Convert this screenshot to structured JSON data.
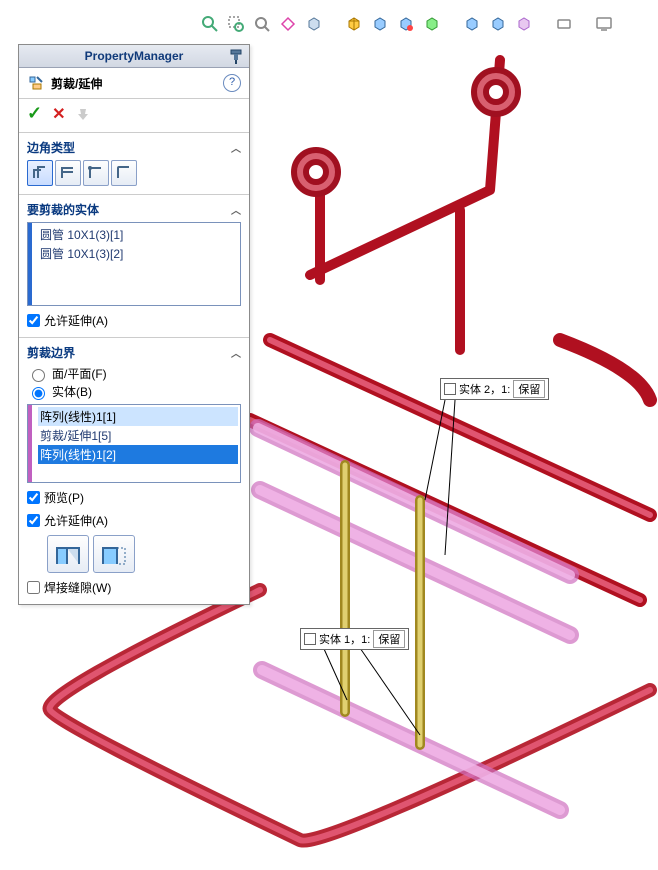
{
  "pm_title": "PropertyManager",
  "feature_name": "剪裁/延伸",
  "sections": {
    "corner": {
      "title": "边角类型"
    },
    "bodies": {
      "title": "要剪裁的实体",
      "items": [
        "圆管 10X1(3)[1]",
        "圆管 10X1(3)[2]"
      ],
      "allow_ext": "允许延伸(A)"
    },
    "boundary": {
      "title": "剪裁边界",
      "r1": "面/平面(F)",
      "r2": "实体(B)",
      "items": [
        "阵列(线性)1[1]",
        "剪裁/延伸1[5]",
        "阵列(线性)1[2]"
      ],
      "preview": "预览(P)",
      "allow_ext": "允许延伸(A)",
      "weld_gap": "焊接缝隙(W)"
    }
  },
  "callouts": {
    "c1": {
      "label": "实体 2，1:",
      "val": "保留"
    },
    "c2": {
      "label": "实体 1，1:",
      "val": "保留"
    }
  }
}
